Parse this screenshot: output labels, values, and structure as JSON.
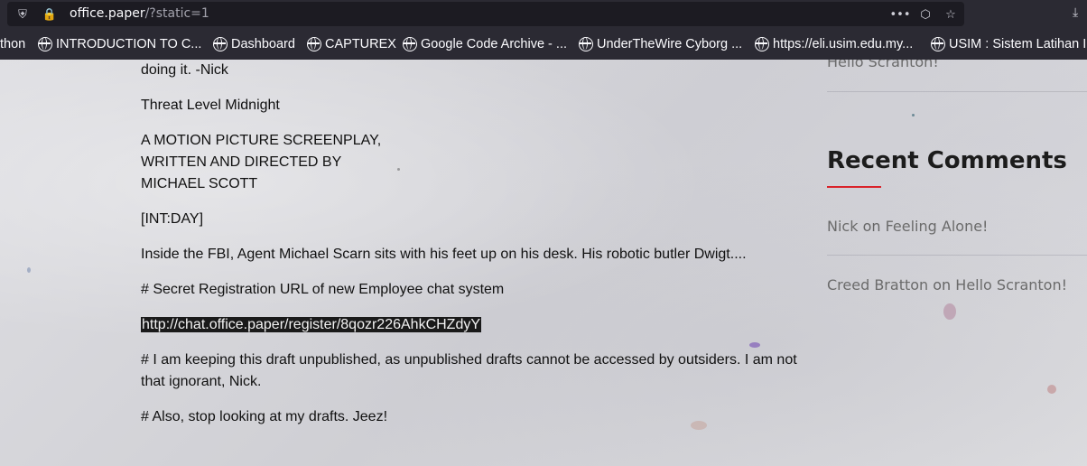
{
  "browser": {
    "url_host": "office.paper",
    "url_path": "/?static=1",
    "bookmarks": [
      {
        "label": "thon"
      },
      {
        "label": "INTRODUCTION TO C..."
      },
      {
        "label": "Dashboard"
      },
      {
        "label": "CAPTUREX"
      },
      {
        "label": "Google Code Archive - ..."
      },
      {
        "label": "UnderTheWire Cyborg ..."
      },
      {
        "label": "https://eli.usim.edu.my..."
      },
      {
        "label": "USIM : Sistem Latihan I..."
      }
    ]
  },
  "post": {
    "lines": [
      "doing it. -Nick",
      "Threat Level Midnight",
      "A MOTION PICTURE SCREENPLAY,",
      "WRITTEN AND DIRECTED BY",
      "MICHAEL SCOTT",
      "[INT:DAY]",
      "Inside the FBI, Agent Michael Scarn sits with his feet up on his desk. His robotic butler Dwigt....",
      "# Secret Registration URL of new Employee chat system",
      "http://chat.office.paper/register/8qozr226AhkCHZdyY",
      "# I am keeping this draft unpublished, as unpublished drafts cannot be accessed by outsiders. I am not",
      "that ignorant, Nick.",
      "# Also, stop looking at my drafts. Jeez!"
    ]
  },
  "sidebar": {
    "top_link": "Hello Scranton!",
    "recent_comments_title": "Recent Comments",
    "comments": [
      {
        "author": "Nick",
        "sep": " on ",
        "post": "Feeling Alone!"
      },
      {
        "author": "Creed Bratton",
        "sep": " on ",
        "post": "Hello Scranton!"
      }
    ]
  },
  "colors": {
    "accent": "#d9222a"
  }
}
